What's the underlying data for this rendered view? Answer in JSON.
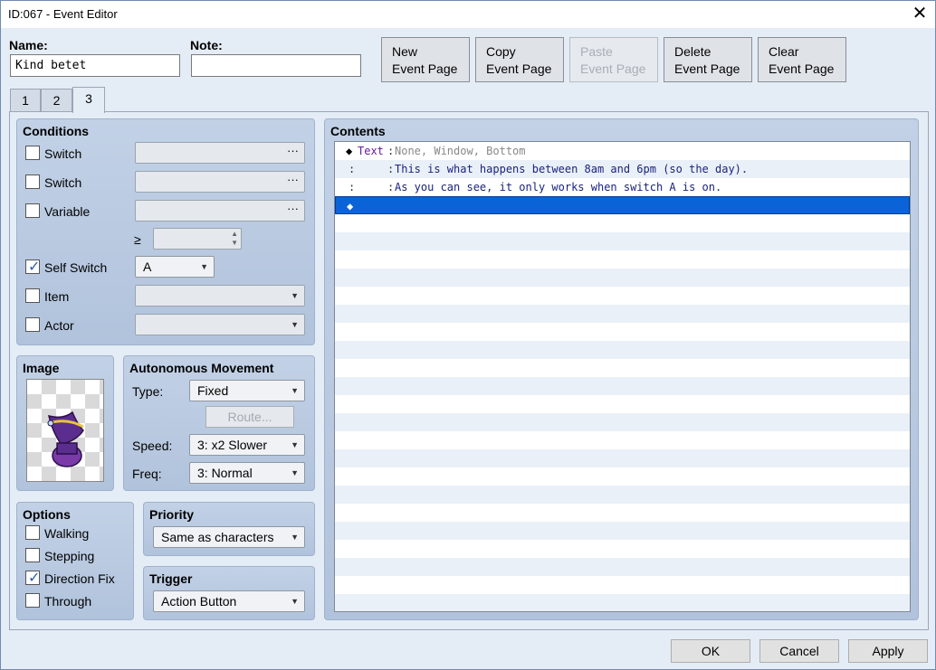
{
  "window": {
    "title": "ID:067 - Event Editor",
    "close_glyph": "✕"
  },
  "header": {
    "name_label": "Name:",
    "name_value": "Kind betet",
    "note_label": "Note:",
    "note_value": "",
    "buttons": [
      {
        "line1": "New",
        "line2": "Event Page",
        "enabled": true
      },
      {
        "line1": "Copy",
        "line2": "Event Page",
        "enabled": true
      },
      {
        "line1": "Paste",
        "line2": "Event Page",
        "enabled": false
      },
      {
        "line1": "Delete",
        "line2": "Event Page",
        "enabled": true
      },
      {
        "line1": "Clear",
        "line2": "Event Page",
        "enabled": true
      }
    ]
  },
  "tabs": [
    {
      "label": "1"
    },
    {
      "label": "2"
    },
    {
      "label": "3",
      "active": true
    }
  ],
  "conditions": {
    "title": "Conditions",
    "switch1": {
      "label": "Switch",
      "checked": false,
      "value": ""
    },
    "switch2": {
      "label": "Switch",
      "checked": false,
      "value": ""
    },
    "variable": {
      "label": "Variable",
      "checked": false,
      "value": ""
    },
    "compare_symbol": "≥",
    "variable_amount": "",
    "self_switch": {
      "label": "Self Switch",
      "checked": true,
      "value": "A"
    },
    "item": {
      "label": "Item",
      "checked": false,
      "value": ""
    },
    "actor": {
      "label": "Actor",
      "checked": false,
      "value": ""
    },
    "dots": "···"
  },
  "image": {
    "title": "Image",
    "sprite": "purple-wizard-hat-character"
  },
  "movement": {
    "title": "Autonomous Movement",
    "type_label": "Type:",
    "type_value": "Fixed",
    "route_label": "Route...",
    "speed_label": "Speed:",
    "speed_value": "3: x2 Slower",
    "freq_label": "Freq:",
    "freq_value": "3: Normal"
  },
  "options": {
    "title": "Options",
    "walking": {
      "label": "Walking",
      "checked": false
    },
    "stepping": {
      "label": "Stepping",
      "checked": false
    },
    "direction_fix": {
      "label": "Direction Fix",
      "checked": true
    },
    "through": {
      "label": "Through",
      "checked": false
    }
  },
  "priority": {
    "title": "Priority",
    "value": "Same as characters"
  },
  "trigger": {
    "title": "Trigger",
    "value": "Action Button"
  },
  "contents": {
    "title": "Contents",
    "commands": [
      {
        "marker": "◆",
        "name": "Text",
        "sep": ":",
        "text": "None, Window, Bottom",
        "color": "#888888"
      },
      {
        "marker": "",
        "name": ":",
        "sep": ":",
        "text": "This is what happens between 8am and 6pm (so the day).",
        "color": "#1a237e"
      },
      {
        "marker": "",
        "name": ":",
        "sep": ":",
        "text": "As you can see, it only works when switch A is on.",
        "color": "#1a237e"
      },
      {
        "marker": "◆",
        "name": "",
        "sep": "",
        "text": "",
        "color": "#ffffff",
        "selected": true
      }
    ]
  },
  "footer": {
    "ok": "OK",
    "cancel": "Cancel",
    "apply": "Apply"
  }
}
